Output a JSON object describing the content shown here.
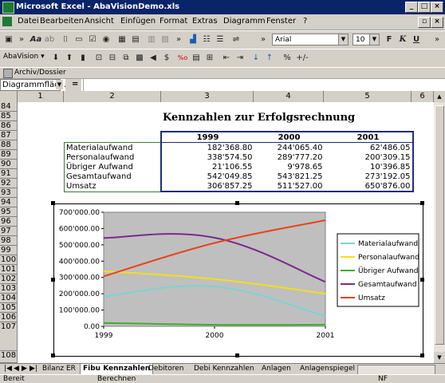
{
  "window": {
    "title": "Microsoft Excel - AbaVisionDemo.xls"
  },
  "menu": {
    "items": [
      "Datei",
      "Bearbeiten",
      "Ansicht",
      "Einfügen",
      "Format",
      "Extras",
      "Diagramm",
      "Fenster",
      "?"
    ]
  },
  "toolbar": {
    "font_name": "Arial",
    "font_size": "10",
    "bold": "F",
    "italic": "K",
    "underline": "U",
    "percent": "%",
    "plusminus": "+/-"
  },
  "toolbar2": {
    "abavision": "AbaVision ▾"
  },
  "toolbar3": {
    "archiv": "Archiv/Dossier"
  },
  "namebox": {
    "value": "Diagrammfläc..."
  },
  "formula": {
    "equals": "="
  },
  "columns": [
    "1",
    "2",
    "3",
    "4",
    "5",
    "6"
  ],
  "rows": [
    "84",
    "85",
    "86",
    "87",
    "88",
    "89",
    "90",
    "91",
    "92",
    "93",
    "94",
    "95",
    "96",
    "97",
    "98",
    "99",
    "100",
    "101",
    "102",
    "103",
    "104",
    "105",
    "106",
    "107",
    "108"
  ],
  "sheet": {
    "heading": "Kennzahlen zur Erfolgsrechnung",
    "table": {
      "years": [
        "1999",
        "2000",
        "2001"
      ],
      "rows": [
        {
          "label": "Materialaufwand",
          "values": [
            "182'368.80",
            "244'065.40",
            "62'486.05"
          ]
        },
        {
          "label": "Personalaufwand",
          "values": [
            "338'574.50",
            "289'777.20",
            "200'309.15"
          ]
        },
        {
          "label": "Übriger Aufwand",
          "values": [
            "21'106.55",
            "9'978.65",
            "10'396.85"
          ]
        },
        {
          "label": "Gesamtaufwand",
          "values": [
            "542'049.85",
            "543'821.25",
            "273'192.05"
          ]
        },
        {
          "label": "Umsatz",
          "values": [
            "306'857.25",
            "511'527.00",
            "650'876.00"
          ]
        }
      ]
    }
  },
  "chart_data": {
    "type": "line",
    "title": "",
    "xlabel": "",
    "ylabel": "",
    "categories": [
      "1999",
      "2000",
      "2001"
    ],
    "ylim": [
      0,
      700000
    ],
    "yticks": [
      "0.00",
      "100'000.00",
      "200'000.00",
      "300'000.00",
      "400'000.00",
      "500'000.00",
      "600'000.00",
      "700'000.00"
    ],
    "plot_background": "#bfbfbf",
    "legend_position": "right",
    "series": [
      {
        "name": "Materialaufwand",
        "color": "#7ad3d3",
        "values": [
          182368.8,
          244065.4,
          62486.05
        ]
      },
      {
        "name": "Personalaufwand",
        "color": "#f2e01c",
        "values": [
          338574.5,
          289777.2,
          200309.15
        ]
      },
      {
        "name": "Übriger Aufwand",
        "color": "#3fae2a",
        "values": [
          21106.55,
          9978.65,
          10396.85
        ]
      },
      {
        "name": "Gesamtaufwand",
        "color": "#7b2a8c",
        "values": [
          542049.85,
          543821.25,
          273192.05
        ]
      },
      {
        "name": "Umsatz",
        "color": "#e8421b",
        "values": [
          306857.25,
          511527.0,
          650876.0
        ]
      }
    ]
  },
  "sheet_tabs": [
    "Bilanz ER",
    "Fibu Kennzahlen",
    "Debitoren",
    "Debi Kennzahlen",
    "Anlagen",
    "Anlagenspiegel"
  ],
  "status": {
    "left": "Bereit",
    "middle": "Berechnen",
    "nf": "NF"
  }
}
